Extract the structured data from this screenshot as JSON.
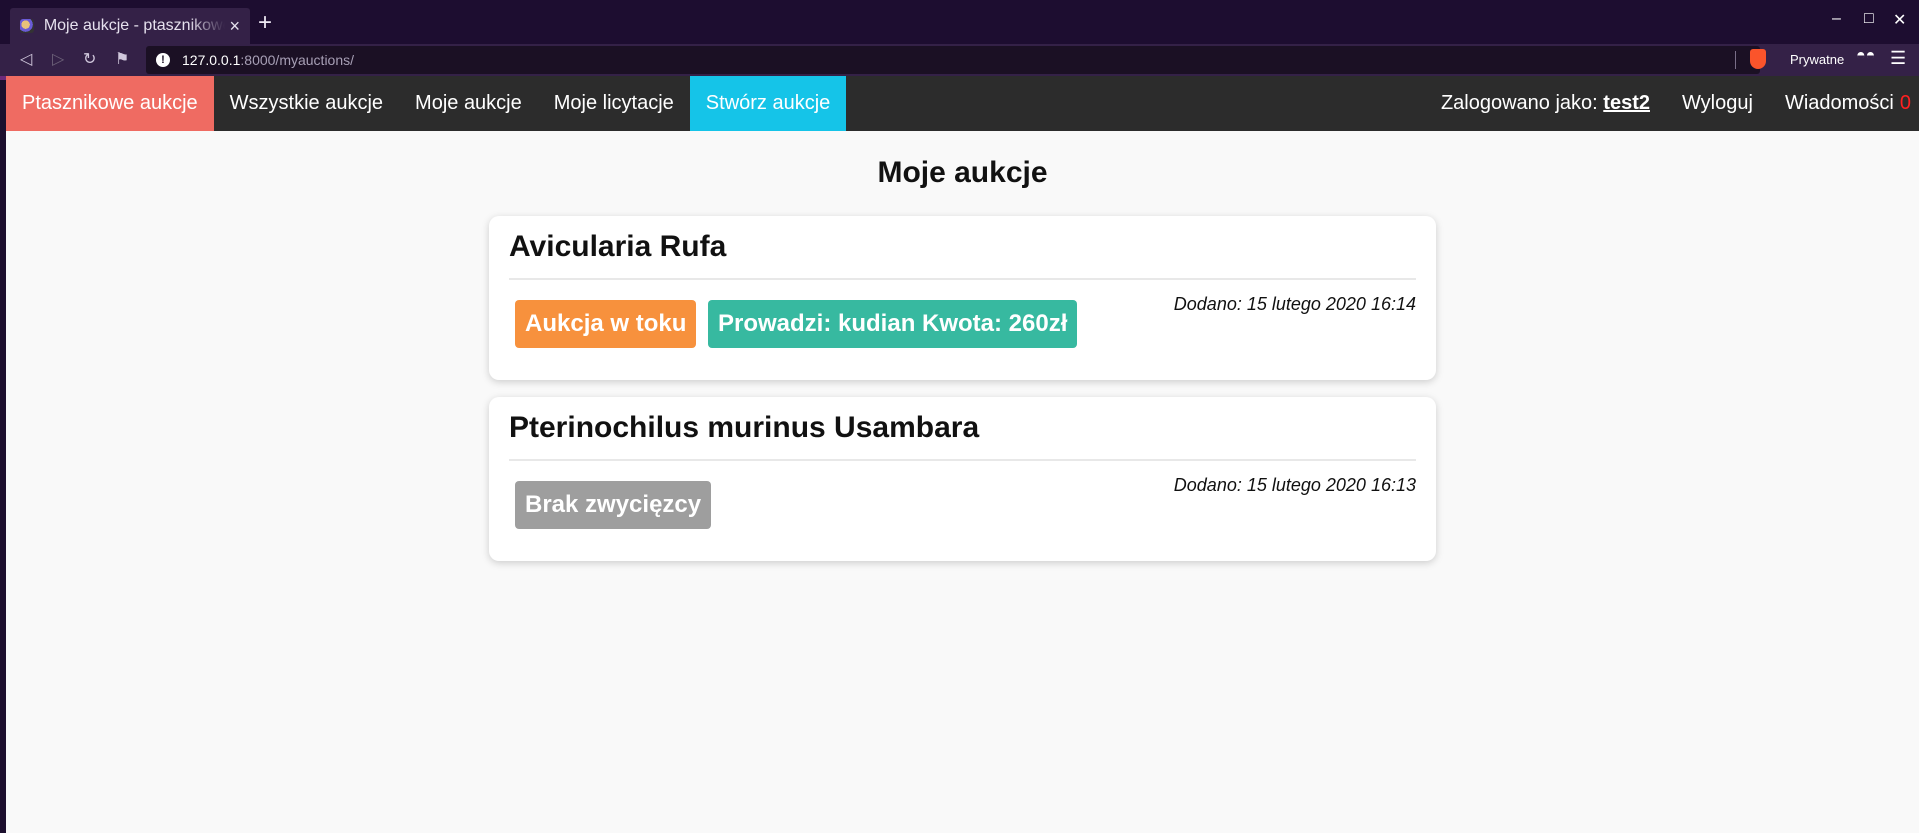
{
  "browser": {
    "tab_title": "Moje aukcje - ptasznikowe aukcje",
    "tab_close": "×",
    "new_tab": "+",
    "url_host": "127.0.0.1",
    "url_rest": ":8000/myauctions/",
    "private_label": "Prywatne",
    "icons": [
      "back-icon",
      "forward-icon",
      "reload-icon",
      "bookmark-icon",
      "info-icon",
      "brave-shield-icon",
      "private-glasses-icon",
      "menu-icon"
    ]
  },
  "nav": {
    "brand": "Ptasznikowe aukcje",
    "all_auctions": "Wszystkie aukcje",
    "my_auctions": "Moje aukcje",
    "my_bids": "Moje licytacje",
    "create_auction": "Stwórz aukcje",
    "logged_in_as": "Zalogowano jako: ",
    "username": "test2",
    "logout": "Wyloguj",
    "messages": "Wiadomości",
    "messages_count": "0"
  },
  "page_title": "Moje aukcje",
  "auctions": [
    {
      "title": "Avicularia Rufa",
      "date": "Dodano: 15 lutego 2020 16:14",
      "status": "Aukcja w toku",
      "leader": "Prowadzi: kudian Kwota: 260zł"
    },
    {
      "title": "Pterinochilus murinus Usambara",
      "date": "Dodano: 15 lutego 2020 16:13",
      "status": "Brak zwycięzcy"
    }
  ],
  "colors": {
    "brand": "#ef6b62",
    "create": "#15c4e8",
    "status_active": "#f7913d",
    "leader": "#37b9a0",
    "status_none": "#9e9e9e",
    "messages_count": "#ff2020"
  }
}
